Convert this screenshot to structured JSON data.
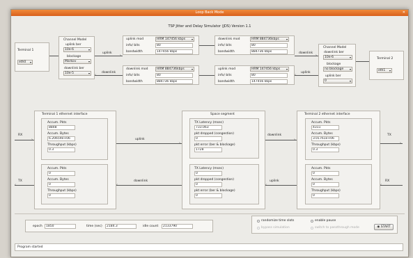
{
  "window": {
    "title": "Loop Back Mode"
  },
  "heading": "TSP Jitter and Delay Simulator (JDS) Version 1.1",
  "terminal1": {
    "label": "Terminal 1",
    "select": "eth0"
  },
  "terminal2": {
    "label": "Terminal 2",
    "select": "eth1"
  },
  "chan1": {
    "title": "Channel Model",
    "uplink_label": "uplink ber",
    "uplink_val": "10e-6",
    "blockage_label": "blockage",
    "blockage_val": "Markov",
    "downlink_label": "downlink ber",
    "downlink_val": "10e-5"
  },
  "chan2": {
    "title": "Channel Model",
    "downlink_label": "downlink ber",
    "downlink_val": "10e-6",
    "blockage_label": "blockage",
    "blockage_val": "no blockage",
    "uplink_label": "uplink ber",
    "uplink_val": "0"
  },
  "arrows": {
    "uplink": "uplink",
    "downlink": "downlink",
    "rx": "RX",
    "tx": "TX"
  },
  "mod_up_left": {
    "mod_label": "uplink mod",
    "mod_val": "HRM 147456 kbps",
    "bits_label": "info/ bits",
    "bits_val": "80",
    "bw_label": "bandwidth",
    "bw_val": "147456 kbps"
  },
  "mod_dn_left": {
    "mod_label": "downlink mod",
    "mod_val": "HRM 884736kbps",
    "bits_label": "info/ bits",
    "bits_val": "80",
    "bw_label": "bandwidth",
    "bw_val": "884736 kbps"
  },
  "mod_dn_right": {
    "mod_label": "downlink mod",
    "mod_val": "HRM 884736kbps",
    "bits_label": "info/ bits",
    "bits_val": "80",
    "bw_label": "bandwidth",
    "bw_val": "884736 kbps"
  },
  "mod_up_right": {
    "mod_label": "uplink mod",
    "mod_val": "HRM 147456 kbps",
    "bits_label": "info/ bits",
    "bits_val": "80",
    "bw_label": "bandwidth",
    "bw_val": "147456 kbps"
  },
  "t1eth": {
    "title": "Terminal 1 ethernet interface",
    "rx": {
      "pkts_label": "Accum. Pkts",
      "pkts": "8848",
      "bytes_label": "Accum. Bytes",
      "bytes": "6.20659e+06",
      "tp_label": "Throughput (kbps)",
      "tp": "0.3"
    },
    "tx": {
      "pkts_label": "Accum. Pkts",
      "pkts": "0",
      "bytes_label": "Accum. Bytes",
      "bytes": "0",
      "tp_label": "Throughput (kbps)",
      "tp": "0"
    }
  },
  "t2eth": {
    "title": "Terminal 2 ethernet interface",
    "tx": {
      "pkts_label": "Accum. Pkts",
      "pkts": "4311",
      "bytes_label": "Accum. Bytes",
      "bytes": "3.01761e+06",
      "tp_label": "Throughput (kbps)",
      "tp": "0.3"
    },
    "rx": {
      "pkts_label": "Accum. Pkts",
      "pkts": "0",
      "bytes_label": "Accum. Bytes",
      "bytes": "0",
      "tp_label": "Throughput (kbps)",
      "tp": "0"
    }
  },
  "space": {
    "title": "Space segment",
    "up": {
      "lat_label": "TX Latency (msec)",
      "lat": "733.063",
      "drop_label": "pkt dropped (congestion)",
      "drop": "0",
      "err_label": "pkt error (ber & blockage)",
      "err": "1728"
    },
    "dn": {
      "lat_label": "TX Latency (msec)",
      "lat": "0",
      "drop_label": "pkt dropped (congestion)",
      "drop": "0",
      "err_label": "pkt error (ber & blockage)",
      "err": "0"
    }
  },
  "bottom": {
    "epoch_label": "epoch",
    "epoch": "1850",
    "time_label": "time (sec)",
    "time": "2184.3",
    "idle_label": "idle count",
    "idle": "2133790"
  },
  "opts": {
    "randomize": "randomize time slots",
    "enable_pause": "enable pause",
    "bypass": "bypass simulation",
    "switch": "switch to passthrough mode",
    "start": "START"
  },
  "status": "Program started"
}
